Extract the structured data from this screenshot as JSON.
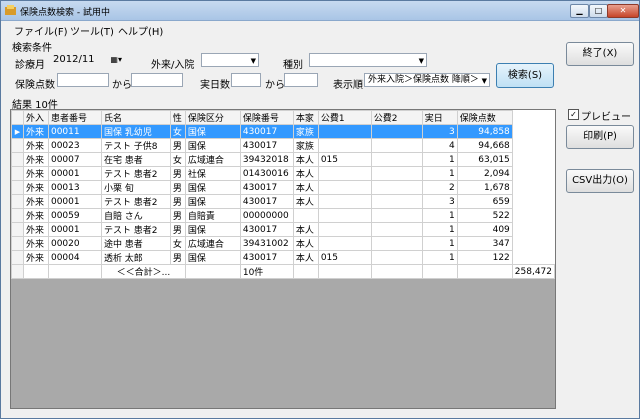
{
  "window": {
    "title": "保険点数検索 - 試用中",
    "minimize": "▁",
    "maximize": "□",
    "close": "✕"
  },
  "menu": [
    "ファイル(F)",
    "ツール(T)",
    "ヘルプ(H)"
  ],
  "search": {
    "group_label": "検索条件",
    "month_label": "診療月",
    "month_value": "2012/11",
    "inout_label": "外来/入院",
    "type_label": "種別",
    "points_label": "保険点数",
    "from_label": "から",
    "days_label": "実日数",
    "from2_label": "から",
    "order_label": "表示順",
    "order_value": "外来入院＞保険点数 降順＞",
    "search_button": "検索(S)"
  },
  "right": {
    "exit": "終了(X)",
    "preview": "プレビュー",
    "print": "印刷(P)",
    "csv": "CSV出力(O)"
  },
  "result_label": "結果  10件",
  "columns": [
    "外入",
    "患者番号",
    "氏名",
    "性",
    "保険区分",
    "保険番号",
    "本家",
    "公費1",
    "公費2",
    "実日",
    "保険点数"
  ],
  "rows": [
    [
      "外来",
      "00011",
      "国保 乳幼児",
      "女",
      "国保",
      "430017",
      "家族",
      "",
      "",
      "3",
      "94,858"
    ],
    [
      "外来",
      "00023",
      "テスト 子供8",
      "男",
      "国保",
      "430017",
      "家族",
      "",
      "",
      "4",
      "94,668"
    ],
    [
      "外来",
      "00007",
      "在宅 患者",
      "女",
      "広域連合",
      "39432018",
      "本人",
      "015",
      "",
      "1",
      "63,015"
    ],
    [
      "外来",
      "00001",
      "テスト 患者2",
      "男",
      "社保",
      "01430016",
      "本人",
      "",
      "",
      "1",
      "2,094"
    ],
    [
      "外来",
      "00013",
      "小栗 旬",
      "男",
      "国保",
      "430017",
      "本人",
      "",
      "",
      "2",
      "1,678"
    ],
    [
      "外来",
      "00001",
      "テスト 患者2",
      "男",
      "国保",
      "430017",
      "本人",
      "",
      "",
      "3",
      "659"
    ],
    [
      "外来",
      "00059",
      "自賠 さん",
      "男",
      "自賠責",
      "00000000",
      "",
      "",
      "",
      "1",
      "522"
    ],
    [
      "外来",
      "00001",
      "テスト 患者2",
      "男",
      "国保",
      "430017",
      "本人",
      "",
      "",
      "1",
      "409"
    ],
    [
      "外来",
      "00020",
      "途中 患者",
      "女",
      "広域連合",
      "39431002",
      "本人",
      "",
      "",
      "1",
      "347"
    ],
    [
      "外来",
      "00004",
      "透析 太郎",
      "男",
      "国保",
      "430017",
      "本人",
      "015",
      "",
      "1",
      "122"
    ]
  ],
  "total_row": {
    "label": "＜＜合計＞...",
    "count": "10件",
    "points": "258,472"
  }
}
